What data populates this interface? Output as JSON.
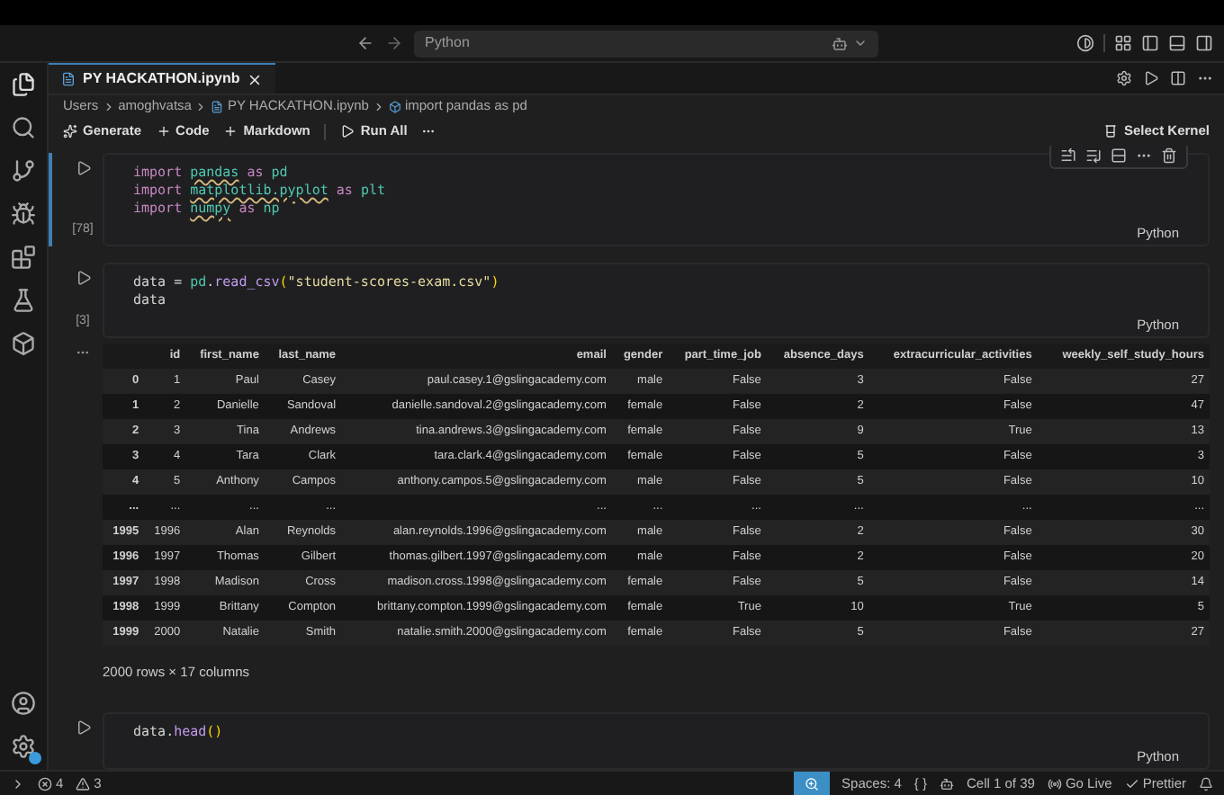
{
  "title_bar": {
    "search": "Python"
  },
  "tab": {
    "label": "PY HACKATHON.ipynb",
    "selected": true
  },
  "breadcrumb": [
    "Users",
    "amoghvatsa",
    "PY HACKATHON.ipynb",
    "import pandas as pd"
  ],
  "toolbar": {
    "buttons": [
      {
        "kind": "generate",
        "label": "Generate"
      },
      {
        "kind": "add",
        "label": "Code"
      },
      {
        "kind": "add",
        "label": "Markdown"
      },
      {
        "kind": "run",
        "label": "Run All"
      }
    ],
    "kernel": "Select Kernel"
  },
  "cells": [
    {
      "count": "[78]",
      "language": "Python",
      "focused": true,
      "lines": [
        [
          {
            "t": "import ",
            "kind": "keyword"
          },
          {
            "t": "pandas",
            "kind": "module"
          },
          {
            "t": " as ",
            "kind": "keyword"
          },
          {
            "t": "pd",
            "kind": "alias"
          }
        ],
        [
          {
            "t": "import ",
            "kind": "keyword"
          },
          {
            "t": "matplotlib.pyplot",
            "kind": "module"
          },
          {
            "t": " as ",
            "kind": "keyword"
          },
          {
            "t": "plt",
            "kind": "alias"
          }
        ],
        [
          {
            "t": "import ",
            "kind": "keyword"
          },
          {
            "t": "numpy",
            "kind": "module"
          },
          {
            "t": " as ",
            "kind": "keyword"
          },
          {
            "t": "np",
            "kind": "alias"
          }
        ]
      ]
    },
    {
      "count": "[3]",
      "language": "Python",
      "focused": false,
      "lines": [
        [
          {
            "t": "data = ",
            "kind": "plain"
          },
          {
            "t": "pd",
            "kind": "alias"
          },
          {
            "t": ".",
            "kind": "plain"
          },
          {
            "t": "read_csv",
            "kind": "func"
          },
          {
            "t": "(",
            "kind": "paren"
          },
          {
            "t": "\"student-scores-exam.csv\"",
            "kind": "string"
          },
          {
            "t": ")",
            "kind": "paren"
          }
        ],
        [
          {
            "t": "data",
            "kind": "plain"
          }
        ]
      ],
      "output": {
        "columns": [
          "",
          "id",
          "first_name",
          "last_name",
          "email",
          "gender",
          "part_time_job",
          "absence_days",
          "extracurricular_activities",
          "weekly_self_study_hours"
        ],
        "rows": [
          [
            "0",
            "1",
            "Paul",
            "Casey",
            "paul.casey.1@gslingacademy.com",
            "male",
            "False",
            "3",
            "False",
            "27"
          ],
          [
            "1",
            "2",
            "Danielle",
            "Sandoval",
            "danielle.sandoval.2@gslingacademy.com",
            "female",
            "False",
            "2",
            "False",
            "47"
          ],
          [
            "2",
            "3",
            "Tina",
            "Andrews",
            "tina.andrews.3@gslingacademy.com",
            "female",
            "False",
            "9",
            "True",
            "13"
          ],
          [
            "3",
            "4",
            "Tara",
            "Clark",
            "tara.clark.4@gslingacademy.com",
            "female",
            "False",
            "5",
            "False",
            "3"
          ],
          [
            "4",
            "5",
            "Anthony",
            "Campos",
            "anthony.campos.5@gslingacademy.com",
            "male",
            "False",
            "5",
            "False",
            "10"
          ],
          [
            "...",
            "...",
            "...",
            "...",
            "...",
            "...",
            "...",
            "...",
            "...",
            "..."
          ],
          [
            "1995",
            "1996",
            "Alan",
            "Reynolds",
            "alan.reynolds.1996@gslingacademy.com",
            "male",
            "False",
            "2",
            "False",
            "30"
          ],
          [
            "1996",
            "1997",
            "Thomas",
            "Gilbert",
            "thomas.gilbert.1997@gslingacademy.com",
            "male",
            "False",
            "2",
            "False",
            "20"
          ],
          [
            "1997",
            "1998",
            "Madison",
            "Cross",
            "madison.cross.1998@gslingacademy.com",
            "female",
            "False",
            "5",
            "False",
            "14"
          ],
          [
            "1998",
            "1999",
            "Brittany",
            "Compton",
            "brittany.compton.1999@gslingacademy.com",
            "female",
            "True",
            "10",
            "True",
            "5"
          ],
          [
            "1999",
            "2000",
            "Natalie",
            "Smith",
            "natalie.smith.2000@gslingacademy.com",
            "female",
            "False",
            "5",
            "False",
            "27"
          ]
        ],
        "summary": "2000 rows × 17 columns"
      }
    },
    {
      "language": "Python",
      "focused": false,
      "lines": [
        [
          {
            "t": "data",
            "kind": "plain"
          },
          {
            "t": ".",
            "kind": "plain"
          },
          {
            "t": "head",
            "kind": "func"
          },
          {
            "t": "()",
            "kind": "paren"
          }
        ]
      ]
    }
  ],
  "status_bar": {
    "errors": "4",
    "warnings": "3",
    "spaces": "Spaces: 4",
    "braces": "{ }",
    "cell": "Cell 1 of 39",
    "live": "Go Live",
    "formatter": "Prettier"
  }
}
